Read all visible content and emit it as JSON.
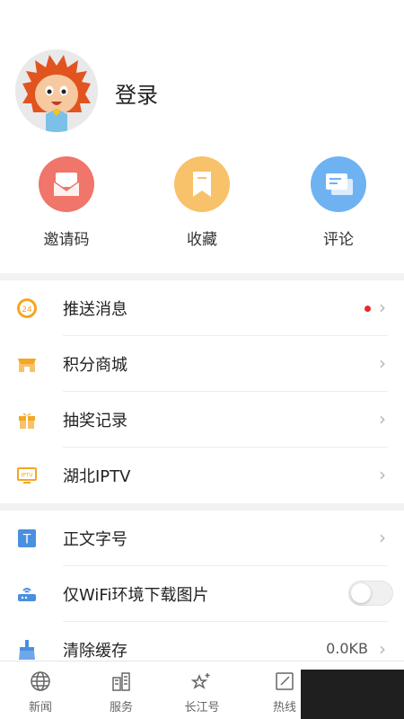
{
  "profile": {
    "login_label": "登录",
    "avatar_icon": "lion-mascot-avatar"
  },
  "quick_actions": [
    {
      "label": "邀请码",
      "icon": "envelope-icon",
      "color": "#f0756a"
    },
    {
      "label": "收藏",
      "icon": "bookmark-icon",
      "color": "#f7c26a"
    },
    {
      "label": "评论",
      "icon": "comment-icon",
      "color": "#6fb2f2"
    }
  ],
  "menu_group1": [
    {
      "label": "推送消息",
      "icon": "push-24-icon",
      "has_dot": true
    },
    {
      "label": "积分商城",
      "icon": "shop-icon"
    },
    {
      "label": "抽奖记录",
      "icon": "gift-icon"
    },
    {
      "label": "湖北IPTV",
      "icon": "tv-icon",
      "badge": "IPTV"
    }
  ],
  "menu_group2": [
    {
      "label": "正文字号",
      "icon": "font-size-icon",
      "glyph": "T"
    },
    {
      "label": "仅WiFi环境下载图片",
      "icon": "router-icon",
      "toggle": false
    },
    {
      "label": "清除缓存",
      "icon": "broom-icon",
      "value": "0.0KB"
    }
  ],
  "push_icon_text": "24",
  "tabs": [
    {
      "label": "新闻",
      "icon": "globe-icon"
    },
    {
      "label": "服务",
      "icon": "building-icon"
    },
    {
      "label": "长江号",
      "icon": "star-wand-icon"
    },
    {
      "label": "热线",
      "icon": "edit-icon"
    }
  ],
  "colors": {
    "accent_orange": "#f5a623",
    "dot_red": "#e8292b"
  }
}
